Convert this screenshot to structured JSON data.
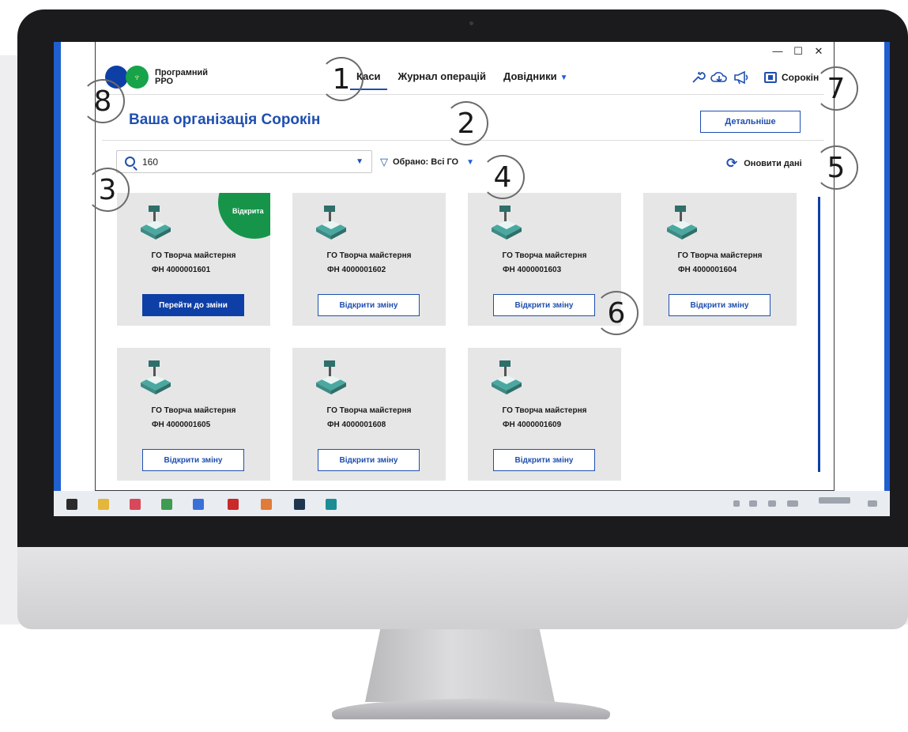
{
  "window": {
    "minimize": "—",
    "maximize": "☐",
    "close": "✕"
  },
  "logo": {
    "emblem": "♆",
    "line1": "Програмний",
    "line2": "РРО"
  },
  "nav": {
    "tabs": [
      {
        "label": "Каси",
        "active": true
      },
      {
        "label": "Журнал операцій",
        "active": false
      },
      {
        "label": "Довідники",
        "active": false
      }
    ],
    "dropdown_icon": "chevron-down-icon"
  },
  "toolbar": {
    "tools_icon": "wrench-icon",
    "sync_icon": "cloud-sync-icon",
    "announce_icon": "megaphone-icon"
  },
  "user": {
    "name": "Сорокін",
    "icon": "building-icon"
  },
  "org": {
    "title": "Ваша організація Сорокін",
    "details_label": "Детальніше"
  },
  "search": {
    "value": "160"
  },
  "filter": {
    "label": "Обрано: Всі ГО"
  },
  "refresh": {
    "label": "Оновити дані"
  },
  "cards": [
    {
      "name": "ГО Творча майстерня",
      "fn": "ФН 4000001601",
      "button": "Перейти до зміни",
      "status": "Відкрита"
    },
    {
      "name": "ГО Творча майстерня",
      "fn": "ФН 4000001602",
      "button": "Відкрити зміну"
    },
    {
      "name": "ГО Творча майстерня",
      "fn": "ФН 4000001603",
      "button": "Відкрити зміну"
    },
    {
      "name": "ГО Творча майстерня",
      "fn": "ФН 4000001604",
      "button": "Відкрити зміну"
    },
    {
      "name": "ГО Творча майстерня",
      "fn": "ФН 4000001605",
      "button": "Відкрити зміну"
    },
    {
      "name": "ГО Творча майстерня",
      "fn": "ФН 4000001608",
      "button": "Відкрити зміну"
    },
    {
      "name": "ГО Творча майстерня",
      "fn": "ФН 4000001609",
      "button": "Відкрити зміну"
    }
  ],
  "markers": [
    "1",
    "2",
    "3",
    "4",
    "5",
    "6",
    "7",
    "8"
  ],
  "colors": {
    "accent": "#1f4fb0",
    "primary": "#0e3fa6",
    "open_badge": "#16954a",
    "card_bg": "#e6e6e6"
  }
}
